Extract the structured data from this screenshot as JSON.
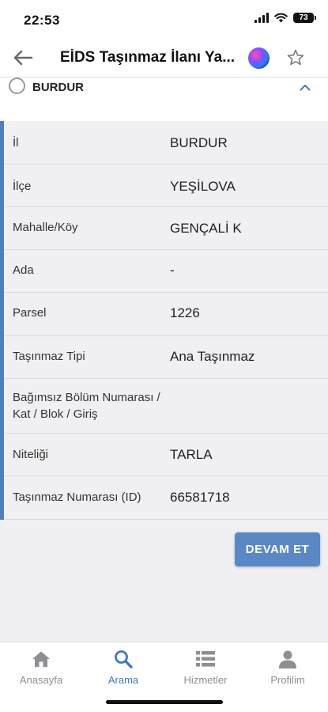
{
  "status_bar": {
    "time": "22:53",
    "battery": "73"
  },
  "nav": {
    "title": "EİDS Taşınmaz İlanı Ya..."
  },
  "section": {
    "title": "BURDUR"
  },
  "details": [
    {
      "label": "İl",
      "value": "BURDUR"
    },
    {
      "label": "İlçe",
      "value": "YEŞİLOVA"
    },
    {
      "label": "Mahalle/Köy",
      "value": "GENÇALİ K"
    },
    {
      "label": "Ada",
      "value": "-"
    },
    {
      "label": "Parsel",
      "value": "1226"
    },
    {
      "label": "Taşınmaz Tipi",
      "value": "Ana Taşınmaz"
    },
    {
      "label": "Bağımsız Bölüm Numarası / Kat / Blok / Giriş",
      "value": ""
    },
    {
      "label": "Niteliği",
      "value": "TARLA"
    },
    {
      "label": "Taşınmaz Numarası (ID)",
      "value": "66581718"
    }
  ],
  "actions": {
    "continue_label": "DEVAM ET"
  },
  "tabs": [
    {
      "label": "Anasayfa",
      "icon": "home-icon",
      "active": false
    },
    {
      "label": "Arama",
      "icon": "search-icon",
      "active": true
    },
    {
      "label": "Hizmetler",
      "icon": "list-icon",
      "active": false
    },
    {
      "label": "Profilim",
      "icon": "person-icon",
      "active": false
    }
  ],
  "colors": {
    "accent": "#4f7fc0",
    "button": "#5a88c5",
    "active_tab": "#3f78c4",
    "inactive_tab": "#8e8e93"
  }
}
